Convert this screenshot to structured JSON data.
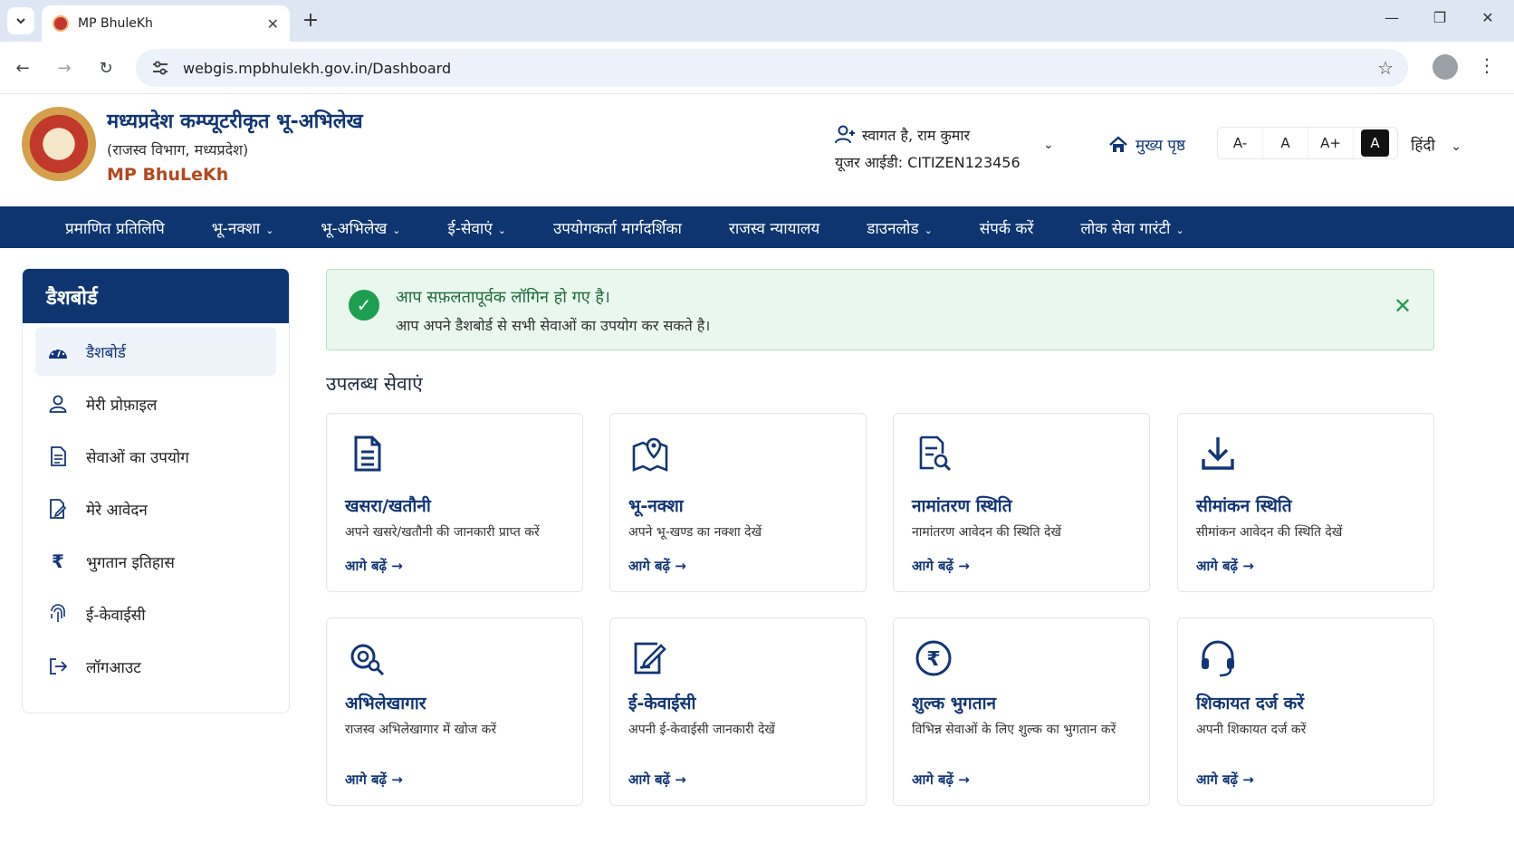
{
  "browser": {
    "tab_title": "MP BhuleKh",
    "url": "webgis.mpbhulekh.gov.in/Dashboard"
  },
  "header": {
    "title": "मध्यप्रदेश कम्प्यूटरीकृत भू-अभिलेख",
    "subtitle": "(राजस्व विभाग, मध्यप्रदेश)",
    "brand": "MP BhuLeKh",
    "welcome": "स्वागत है, राम कुमार",
    "user_id": "यूजर आईडी: CITIZEN123456",
    "home": "मुख्य पृष्ठ",
    "font_sizes": [
      "A-",
      "A",
      "A+",
      "A"
    ],
    "language": "हिंदी"
  },
  "nav": {
    "items": [
      {
        "label": "प्रमाणित प्रतिलिपि",
        "caret": ""
      },
      {
        "label": "भू-नक्शा",
        "caret": "⌄"
      },
      {
        "label": "भू-अभिलेख",
        "caret": "⌄"
      },
      {
        "label": "ई-सेवाएं",
        "caret": "⌄"
      },
      {
        "label": "उपयोगकर्ता मार्गदर्शिका",
        "caret": ""
      },
      {
        "label": "राजस्व न्यायालय",
        "caret": ""
      },
      {
        "label": "डाउनलोड",
        "caret": "⌄"
      },
      {
        "label": "संपर्क करें",
        "caret": ""
      },
      {
        "label": "लोक सेवा गारंटी",
        "caret": "⌄"
      }
    ]
  },
  "sidebar": {
    "heading": "डैशबोर्ड",
    "items": [
      {
        "label": "डैशबोर्ड",
        "icon": "dashboard-icon"
      },
      {
        "label": "मेरी प्रोफ़ाइल",
        "icon": "user-icon"
      },
      {
        "label": "सेवाओं का उपयोग",
        "icon": "document-icon"
      },
      {
        "label": "मेरे आवेदन",
        "icon": "edit-document-icon"
      },
      {
        "label": "भुगतान इतिहास",
        "icon": "rupee-icon"
      },
      {
        "label": "ई-केवाईसी",
        "icon": "fingerprint-icon"
      },
      {
        "label": "लॉगआउट",
        "icon": "logout-icon"
      }
    ]
  },
  "alert": {
    "title": "आप सफ़लतापूर्वक लॉगिन हो गए है।",
    "text": "आप अपने डैशबोर्ड से सभी सेवाओं का उपयोग कर सकते है।"
  },
  "services": {
    "heading": "उपलब्ध सेवाएं",
    "link_label": "आगे बढ़ें →",
    "cards": [
      {
        "title": "खसरा/खतौनी",
        "desc": "अपने खसरे/खतौनी की जानकारी प्राप्त करें",
        "icon": "document-icon"
      },
      {
        "title": "भू-नक्शा",
        "desc": "अपने भू-खण्ड का नक्शा देखें",
        "icon": "map-pin-icon"
      },
      {
        "title": "नामांतरण स्थिति",
        "desc": "नामांतरण आवेदन की स्थिति देखें",
        "icon": "document-search-icon"
      },
      {
        "title": "सीमांकन स्थिति",
        "desc": "सीमांकन आवेदन की स्थिति देखें",
        "icon": "download-icon"
      },
      {
        "title": "अभिलेखागार",
        "desc": "राजस्व अभिलेखागार में खोज करें",
        "icon": "archive-search-icon"
      },
      {
        "title": "ई-केवाईसी",
        "desc": "अपनी ई-केवाईसी जानकारी देखें",
        "icon": "edit-icon"
      },
      {
        "title": "शुल्क भुगतान",
        "desc": "विभिन्न सेवाओं के लिए शुल्क का भुगतान करें",
        "icon": "rupee-circle-icon"
      },
      {
        "title": "शिकायत दर्ज करें",
        "desc": "अपनी शिकायत दर्ज करें",
        "icon": "headset-icon"
      }
    ]
  },
  "colors": {
    "primary": "#0e3570",
    "accent": "#b5471e",
    "success": "#1e9e50"
  }
}
